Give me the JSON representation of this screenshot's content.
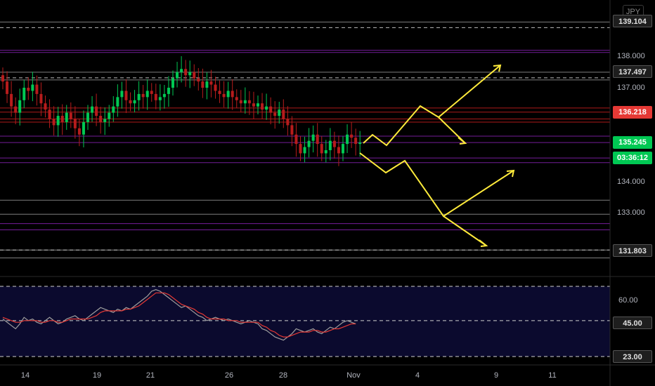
{
  "currency": "JPY",
  "colors": {
    "background": "#000000",
    "up": "#26a69a",
    "up_bright": "#00c853",
    "down": "#b71c1c",
    "price_line": "#ff1744",
    "purple": "#7b1fa2",
    "grey_line": "#9e9e9e",
    "arrows": "#ffeb3b",
    "rsi_fill": "#0b0a2e",
    "rsi_red": "#e53935",
    "rsi_grey": "#9e9e9e"
  },
  "price_axis": {
    "ticks": [
      "138.000",
      "137.000",
      "134.000",
      "133.000"
    ],
    "tags": [
      {
        "label": "139.104",
        "style": "dark"
      },
      {
        "label": "137.497",
        "style": "dark"
      },
      {
        "label": "136.218",
        "style": "red"
      },
      {
        "label": "135.245",
        "style": "green"
      },
      {
        "label": "03:36:12",
        "style": "green"
      },
      {
        "label": "131.803",
        "style": "dark"
      }
    ]
  },
  "rsi_axis": {
    "ticks": [
      "60.00"
    ],
    "tags": [
      {
        "label": "45.00",
        "style": "dark"
      },
      {
        "label": "23.00",
        "style": "dark"
      }
    ]
  },
  "time_axis": [
    "14",
    "19",
    "21",
    "26",
    "28",
    "Nov",
    "4",
    "9",
    "11"
  ],
  "chart_data": {
    "type": "candlestick",
    "ylim": [
      131.5,
      139.3
    ],
    "levels": [
      {
        "value": 139.104,
        "style": "grey"
      },
      {
        "value": 138.2,
        "style": "purple"
      },
      {
        "value": 138.13,
        "style": "purple"
      },
      {
        "value": 137.497,
        "style": "grey"
      },
      {
        "value": 137.25,
        "style": "grey"
      },
      {
        "value": 136.35,
        "style": "red"
      },
      {
        "value": 136.218,
        "style": "red"
      },
      {
        "value": 136.0,
        "style": "red"
      },
      {
        "value": 135.9,
        "style": "red"
      },
      {
        "value": 135.45,
        "style": "purple"
      },
      {
        "value": 135.245,
        "style": "purple"
      },
      {
        "value": 134.75,
        "style": "purple"
      },
      {
        "value": 134.6,
        "style": "purple"
      },
      {
        "value": 133.4,
        "style": "grey"
      },
      {
        "value": 132.95,
        "style": "grey"
      },
      {
        "value": 132.65,
        "style": "purple"
      },
      {
        "value": 132.45,
        "style": "purple"
      },
      {
        "value": 131.803,
        "style": "grey"
      },
      {
        "value": 131.55,
        "style": "grey"
      }
    ],
    "close": [
      137.2,
      136.8,
      136.4,
      136.2,
      136.6,
      137.0,
      136.9,
      137.1,
      136.8,
      136.5,
      136.3,
      136.0,
      135.8,
      136.1,
      135.9,
      136.2,
      136.0,
      135.7,
      135.5,
      135.9,
      136.2,
      136.4,
      136.1,
      135.9,
      136.0,
      136.2,
      136.4,
      136.7,
      136.9,
      136.6,
      136.5,
      136.6,
      136.8,
      136.7,
      136.9,
      136.8,
      136.6,
      136.7,
      136.8,
      137.0,
      137.3,
      137.5,
      137.6,
      137.4,
      137.5,
      137.3,
      137.2,
      137.0,
      137.2,
      137.1,
      136.9,
      136.8,
      136.7,
      136.9,
      136.7,
      136.6,
      136.5,
      136.6,
      136.5,
      136.4,
      136.5,
      136.3,
      136.4,
      136.2,
      136.1,
      136.3,
      136.0,
      135.8,
      135.5,
      135.2,
      134.9,
      135.1,
      135.3,
      135.5,
      135.2,
      134.9,
      135.0,
      135.3,
      135.1,
      134.9,
      135.2,
      135.5,
      135.4,
      135.2,
      135.245
    ],
    "annotations": "projected zig-zag arrows"
  },
  "rsi_data": {
    "ylim": [
      20,
      68
    ],
    "levels": [
      66,
      45,
      23
    ],
    "rsi": [
      46,
      44,
      42,
      40,
      43,
      47,
      45,
      46,
      44,
      43,
      45,
      47,
      45,
      43,
      44,
      46,
      47,
      48,
      46,
      45,
      47,
      49,
      51,
      53,
      52,
      51,
      50,
      52,
      51,
      53,
      52,
      54,
      56,
      58,
      60,
      63,
      64,
      63,
      61,
      59,
      57,
      55,
      53,
      54,
      52,
      50,
      48,
      47,
      45,
      46,
      47,
      46,
      45,
      46,
      45,
      44,
      43,
      44,
      45,
      44,
      43,
      40,
      39,
      37,
      35,
      34,
      33,
      35,
      37,
      40,
      39,
      38,
      39,
      40,
      38,
      37,
      39,
      41,
      40,
      42,
      44,
      45,
      44,
      43
    ],
    "ma": [
      47,
      46,
      45,
      44,
      44,
      45,
      45,
      45,
      45,
      44,
      44,
      45,
      45,
      44,
      44,
      45,
      46,
      46,
      46,
      46,
      46,
      47,
      48,
      50,
      51,
      51,
      51,
      51,
      51,
      52,
      52,
      53,
      54,
      56,
      58,
      60,
      62,
      62,
      62,
      61,
      59,
      57,
      55,
      54,
      53,
      52,
      50,
      49,
      47,
      46,
      46,
      46,
      46,
      45,
      45,
      45,
      44,
      44,
      44,
      44,
      44,
      42,
      41,
      39,
      38,
      36,
      35,
      35,
      36,
      37,
      38,
      38,
      38,
      39,
      39,
      38,
      38,
      39,
      40,
      40,
      41,
      42,
      43,
      43
    ]
  }
}
